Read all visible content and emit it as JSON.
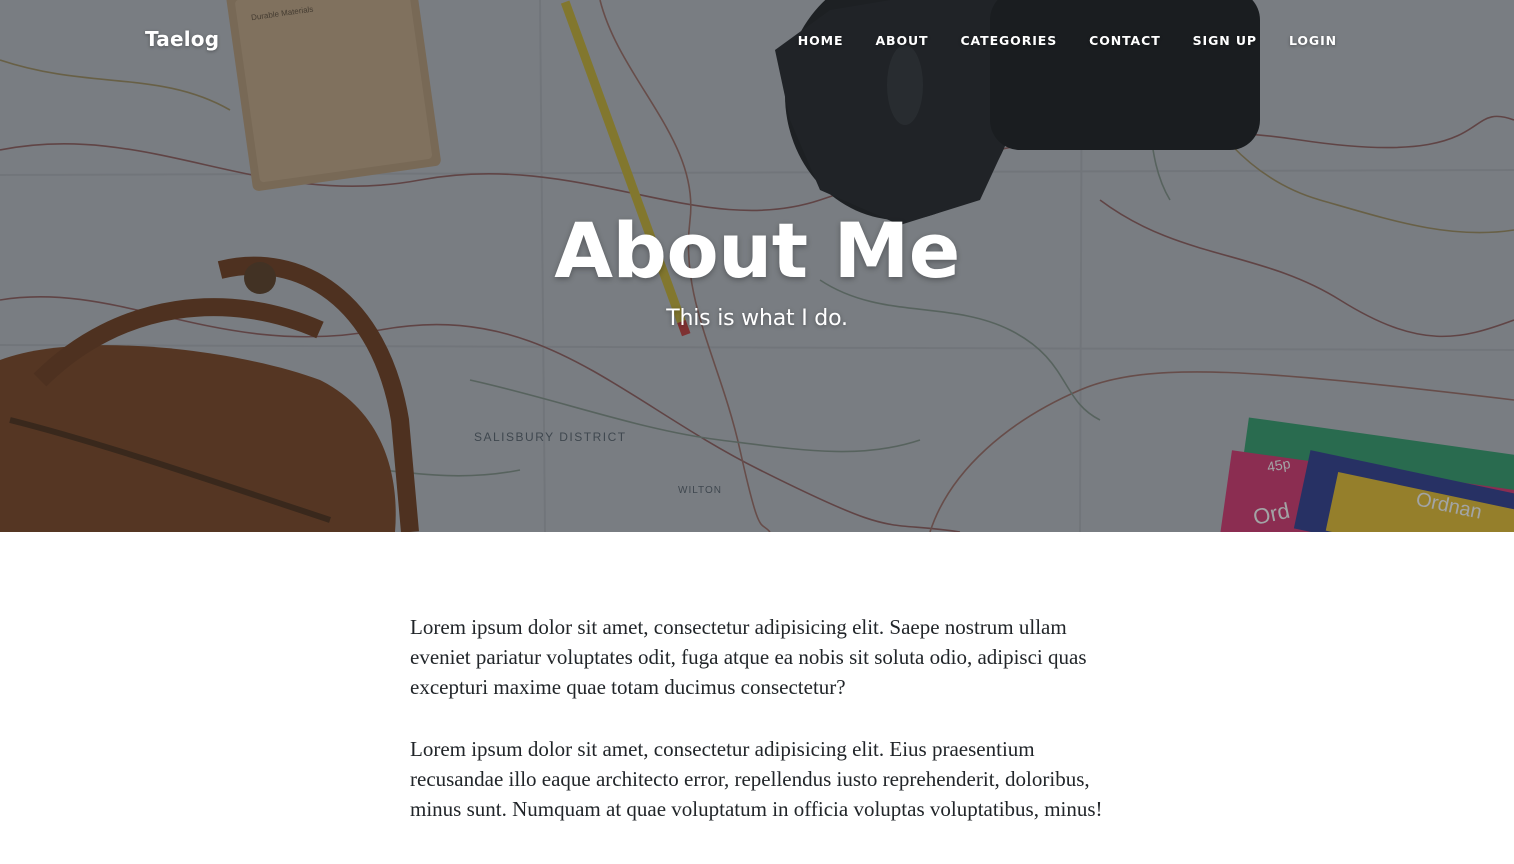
{
  "brand": "Taelog",
  "nav": {
    "items": [
      "HOME",
      "ABOUT",
      "CATEGORIES",
      "CONTACT",
      "SIGN UP",
      "LOGIN"
    ]
  },
  "hero": {
    "title": "About Me",
    "subtitle": "This is what I do.",
    "map_label_salisbury": "SALISBURY  DISTRICT",
    "map_label_wilton": "WILTON",
    "map_sticker_price": "45p",
    "map_book_text": "Ordnan",
    "map_book_text_2": "Ord",
    "notebook_text": "Durable Materials",
    "overlay_color": "#212529"
  },
  "content": {
    "paragraphs": [
      "Lorem ipsum dolor sit amet, consectetur adipisicing elit. Saepe nostrum ullam eveniet pariatur voluptates odit, fuga atque ea nobis sit soluta odio, adipisci quas excepturi maxime quae totam ducimus consectetur?",
      "Lorem ipsum dolor sit amet, consectetur adipisicing elit. Eius praesentium recusandae illo eaque architecto error, repellendus iusto reprehenderit, doloribus, minus sunt. Numquam at quae voluptatum in officia voluptas voluptatibus, minus!"
    ]
  }
}
